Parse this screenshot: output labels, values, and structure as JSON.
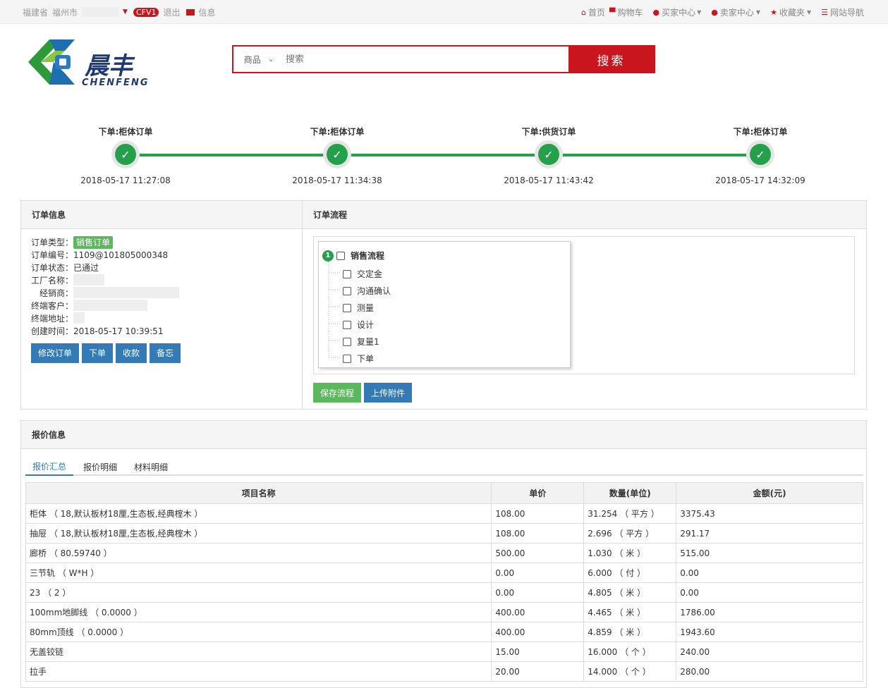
{
  "topbar": {
    "province": "福建省",
    "city": "福州市",
    "version_badge": "CFV1",
    "logout": "退出",
    "messages": "信息",
    "nav": [
      {
        "label": "首页",
        "icon": "home-icon"
      },
      {
        "label": "购物车",
        "icon": "cart-icon"
      },
      {
        "label": "买家中心",
        "icon": "user-icon"
      },
      {
        "label": "卖家中心",
        "icon": "user-icon"
      },
      {
        "label": "收藏夹",
        "icon": "star-icon"
      },
      {
        "label": "网站导航",
        "icon": "list-icon"
      }
    ]
  },
  "logo": {
    "text_cn": "晨丰",
    "text_en": "CHENFENG"
  },
  "search": {
    "category": "商品",
    "placeholder": "搜索",
    "button": "搜索"
  },
  "steps": [
    {
      "title": "下单:柜体订单",
      "time": "2018-05-17 11:27:08"
    },
    {
      "title": "下单:柜体订单",
      "time": "2018-05-17 11:34:38"
    },
    {
      "title": "下单:供货订单",
      "time": "2018-05-17 11:43:42"
    },
    {
      "title": "下单:柜体订单",
      "time": "2018-05-17 14:32:09"
    }
  ],
  "order_info": {
    "title": "订单信息",
    "type_label": "订单类型：",
    "type_value": "销售订单",
    "no_label": "订单编号：",
    "no_value": "1109@101805000348",
    "status_label": "订单状态：",
    "status_value": "已通过",
    "factory_label": "工厂名称：",
    "dealer_label": "经销商：",
    "customer_label": "终端客户：",
    "address_label": "终端地址：",
    "created_label": "创建时间：",
    "created_value": "2018-05-17 10:39:51",
    "buttons": [
      "修改订单",
      "下单",
      "收款",
      "备忘"
    ]
  },
  "order_flow": {
    "title": "订单流程",
    "root_num": "1",
    "root": "销售流程",
    "children": [
      "交定金",
      "沟通确认",
      "测量",
      "设计",
      "复量1",
      "下单"
    ],
    "save_button": "保存流程",
    "upload_button": "上传附件"
  },
  "quote": {
    "title": "报价信息",
    "tabs": [
      "报价汇总",
      "报价明细",
      "材料明细"
    ],
    "columns": [
      "项目名称",
      "单价",
      "数量(单位)",
      "金额(元)"
    ],
    "rows": [
      [
        "柜体 （ 18,默认板材18厘,生态板,经典榁木 ）",
        "108.00",
        "31.254 （ 平方 ）",
        "3375.43"
      ],
      [
        "抽屉 （ 18,默认板材18厘,生态板,经典榁木 ）",
        "108.00",
        "2.696 （ 平方 ）",
        "291.17"
      ],
      [
        "廊桥 （ 80.59740 ）",
        "500.00",
        "1.030 （ 米 ）",
        "515.00"
      ],
      [
        "三节轨 （ W*H ）",
        "0.00",
        "6.000 （ 付 ）",
        "0.00"
      ],
      [
        "23 （ 2 ）",
        "0.00",
        "4.805 （ 米 ）",
        "0.00"
      ],
      [
        "100mm地脚线 （ 0.0000 ）",
        "400.00",
        "4.465 （ 米 ）",
        "1786.00"
      ],
      [
        "80mm顶线 （ 0.0000 ）",
        "400.00",
        "4.859 （ 米 ）",
        "1943.60"
      ],
      [
        "无盖铰链",
        "15.00",
        "16.000 （ 个 ）",
        "240.00"
      ],
      [
        "拉手",
        "20.00",
        "14.000 （ 个 ）",
        "280.00"
      ]
    ]
  },
  "colors": {
    "brand_red": "#c9151e",
    "progress_green": "#24a04a",
    "button_blue": "#337ab7",
    "button_green": "#5cb85c"
  }
}
